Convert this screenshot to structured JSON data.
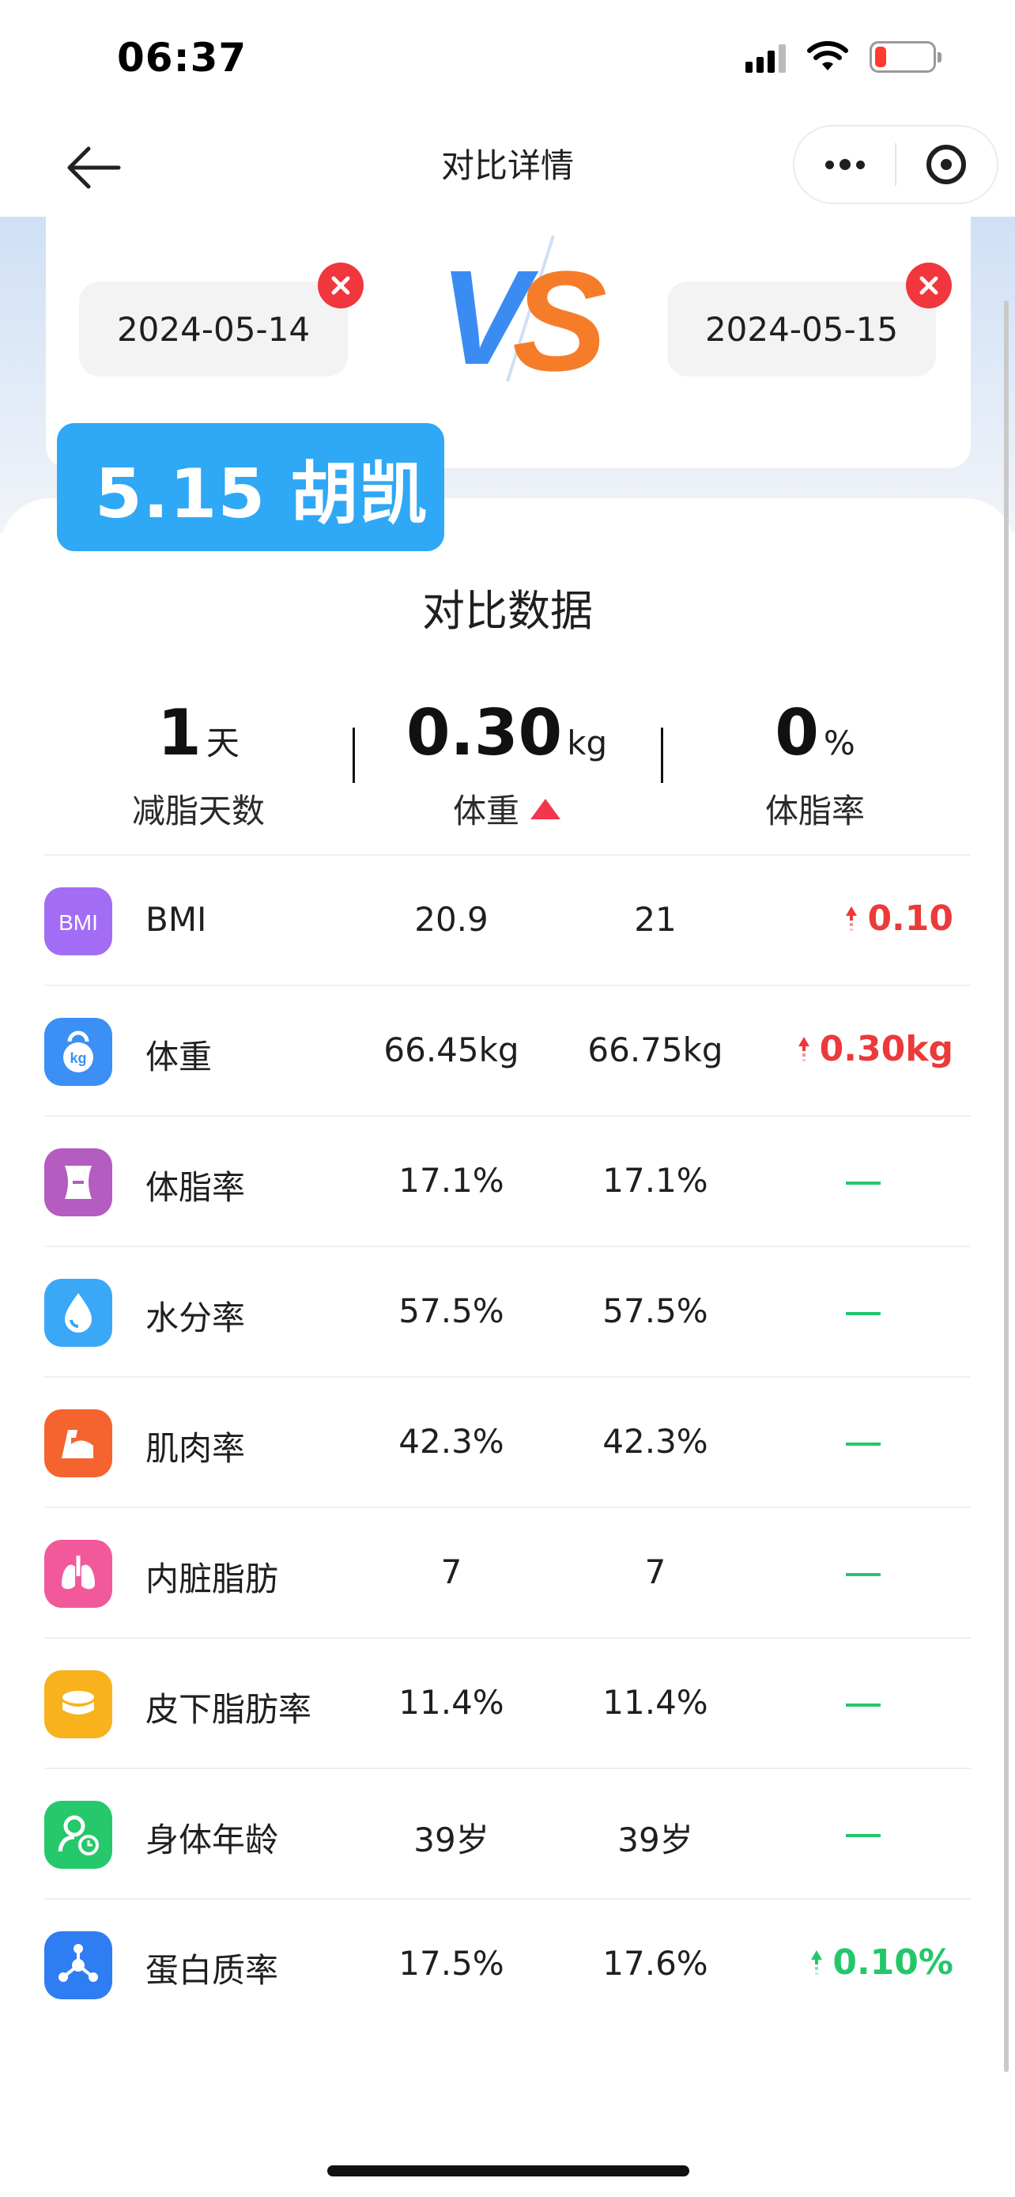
{
  "status_bar": {
    "time": "06:37",
    "battery_level": 0.2,
    "battery_color": "#ff3b30"
  },
  "nav": {
    "title": "对比详情",
    "back_icon": "arrow-left-icon",
    "more_icon": "more-dots-icon",
    "close_icon": "target-circle-icon"
  },
  "compare": {
    "date_left": "2024-05-14",
    "date_right": "2024-05-15",
    "vs_label": "VS",
    "remove_color": "#f2363e"
  },
  "user_badge": {
    "label": "5.15 胡凯",
    "color": "#2fa8f5"
  },
  "section_title": "对比数据",
  "summary": [
    {
      "value": "1",
      "unit": "天",
      "label": "减脂天数"
    },
    {
      "value": "0.30",
      "unit": "kg",
      "label": "体重",
      "trend": "up"
    },
    {
      "value": "0",
      "unit": "%",
      "label": "体脂率"
    }
  ],
  "rows": [
    {
      "name": "BMI",
      "icon": "bmi-icon",
      "icon_color": "#a36cf5",
      "v1": "20.9",
      "v2": "21",
      "diff": "0.10",
      "trend": "up"
    },
    {
      "name": "体重",
      "icon": "kettlebell-icon",
      "icon_color": "#3b8ff5",
      "v1": "66.45kg",
      "v2": "66.75kg",
      "diff": "0.30kg",
      "trend": "up"
    },
    {
      "name": "体脂率",
      "icon": "body-fat-icon",
      "icon_color": "#b45cc0",
      "v1": "17.1%",
      "v2": "17.1%",
      "diff": "",
      "trend": "none"
    },
    {
      "name": "水分率",
      "icon": "water-drop-icon",
      "icon_color": "#3aa7f7",
      "v1": "57.5%",
      "v2": "57.5%",
      "diff": "",
      "trend": "none"
    },
    {
      "name": "肌肉率",
      "icon": "muscle-icon",
      "icon_color": "#f5632f",
      "v1": "42.3%",
      "v2": "42.3%",
      "diff": "",
      "trend": "none"
    },
    {
      "name": "内脏脂肪",
      "icon": "lungs-icon",
      "icon_color": "#f2599b",
      "v1": "7",
      "v2": "7",
      "diff": "",
      "trend": "none"
    },
    {
      "name": "皮下脂肪率",
      "icon": "subcutaneous-fat-icon",
      "icon_color": "#f7b21c",
      "v1": "11.4%",
      "v2": "11.4%",
      "diff": "",
      "trend": "none"
    },
    {
      "name": "身体年龄",
      "icon": "body-age-icon",
      "icon_color": "#25c86a",
      "v1": "39岁",
      "v2": "39岁",
      "diff": "",
      "trend": "none"
    },
    {
      "name": "蛋白质率",
      "icon": "protein-molecule-icon",
      "icon_color": "#2f7df2",
      "v1": "17.5%",
      "v2": "17.6%",
      "diff": "0.10%",
      "trend": "up-green"
    }
  ],
  "colors": {
    "up_red": "#ec3a3a",
    "up_green": "#23c76a",
    "neutral_dash": "#23c76a"
  }
}
